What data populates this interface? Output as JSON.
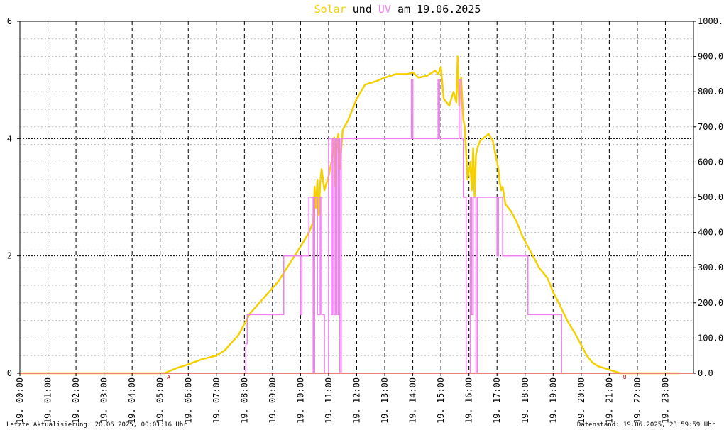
{
  "chart_data": {
    "type": "line",
    "title": {
      "part_solar": "Solar",
      "part_und": " und ",
      "part_uv": "UV",
      "part_date": " am 19.06.2025"
    },
    "colors": {
      "solar": "#f5d000",
      "uv": "#ee82ee",
      "baseline": "#f08080",
      "grid": "#000000",
      "marker": "#d00000"
    },
    "left_axis": {
      "label": "UV",
      "range": [
        0,
        6
      ],
      "ticks": [
        "0",
        "2",
        "4",
        "6"
      ]
    },
    "right_axis": {
      "label": "Solar",
      "range": [
        0,
        1000
      ],
      "ticks": [
        "0.0",
        "100.0",
        "200.0",
        "300.0",
        "400.0",
        "500.0",
        "600.0",
        "700.0",
        "800.0",
        "900.0",
        "1000.0"
      ]
    },
    "x_axis": {
      "range": [
        0,
        24
      ],
      "ticks": [
        "19. 00:00",
        "19. 01:00",
        "19. 02:00",
        "19. 03:00",
        "19. 04:00",
        "19. 05:00",
        "19. 06:00",
        "19. 07:00",
        "19. 08:00",
        "19. 09:00",
        "19. 10:00",
        "19. 11:00",
        "19. 12:00",
        "19. 13:00",
        "19. 14:00",
        "19. 15:00",
        "19. 16:00",
        "19. 17:00",
        "19. 18:00",
        "19. 19:00",
        "19. 20:00",
        "19. 21:00",
        "19. 22:00",
        "19. 23:00"
      ]
    },
    "grid": true,
    "markers": [
      {
        "label": "A",
        "x": 5.3
      },
      {
        "label": "U",
        "x": 21.55
      }
    ],
    "series": [
      {
        "name": "Solar",
        "axis": "right",
        "x": [
          0,
          5.15,
          5.3,
          5.6,
          6.0,
          6.5,
          7.0,
          7.3,
          7.8,
          8.2,
          8.7,
          9.2,
          9.6,
          10.0,
          10.3,
          10.45,
          10.5,
          10.55,
          10.6,
          10.65,
          10.7,
          10.75,
          10.85,
          11.0,
          11.1,
          11.15,
          11.2,
          11.25,
          11.3,
          11.35,
          11.4,
          11.5,
          11.7,
          12.0,
          12.3,
          12.7,
          13.0,
          13.4,
          13.8,
          14.0,
          14.2,
          14.5,
          14.8,
          14.9,
          15.0,
          15.1,
          15.3,
          15.45,
          15.55,
          15.6,
          15.65,
          15.72,
          15.8,
          15.85,
          15.95,
          16.05,
          16.1,
          16.15,
          16.2,
          16.25,
          16.3,
          16.4,
          16.55,
          16.7,
          16.85,
          16.95,
          17.05,
          17.1,
          17.15,
          17.2,
          17.3,
          17.5,
          17.7,
          17.9,
          18.1,
          18.3,
          18.5,
          18.8,
          19.0,
          19.2,
          19.5,
          19.8,
          20.0,
          20.2,
          20.4,
          20.6,
          20.8,
          21.0,
          21.2,
          21.4,
          21.6,
          21.8,
          22.0,
          23.5
        ],
        "values": [
          0,
          0,
          5,
          15,
          25,
          40,
          50,
          65,
          110,
          170,
          215,
          260,
          310,
          360,
          400,
          430,
          530,
          470,
          550,
          450,
          540,
          580,
          520,
          560,
          600,
          620,
          670,
          530,
          650,
          680,
          580,
          690,
          720,
          780,
          820,
          830,
          840,
          850,
          850,
          855,
          840,
          845,
          860,
          850,
          870,
          780,
          760,
          800,
          770,
          900,
          760,
          840,
          720,
          700,
          550,
          600,
          520,
          640,
          500,
          620,
          640,
          660,
          670,
          680,
          660,
          620,
          580,
          540,
          520,
          530,
          480,
          460,
          430,
          390,
          360,
          330,
          300,
          270,
          230,
          200,
          150,
          110,
          80,
          50,
          30,
          20,
          15,
          10,
          5,
          0,
          0,
          0,
          0,
          0
        ]
      },
      {
        "name": "UV",
        "axis": "left",
        "x": [
          0,
          8.05,
          8.05,
          8.1,
          8.1,
          9.4,
          9.4,
          10.0,
          10.0,
          10.05,
          10.05,
          10.3,
          10.3,
          10.45,
          10.45,
          10.5,
          10.5,
          10.6,
          10.6,
          10.7,
          10.7,
          10.75,
          10.75,
          10.85,
          10.85,
          11.0,
          11.0,
          11.1,
          11.1,
          11.15,
          11.15,
          11.2,
          11.2,
          11.25,
          11.25,
          11.3,
          11.3,
          11.35,
          11.35,
          11.4,
          11.4,
          11.45,
          11.45,
          13.95,
          13.95,
          14.0,
          14.0,
          14.9,
          14.9,
          14.95,
          14.95,
          15.65,
          15.65,
          15.72,
          15.72,
          15.8,
          15.8,
          15.9,
          15.9,
          16.05,
          16.05,
          16.1,
          16.1,
          16.15,
          16.15,
          16.25,
          16.25,
          16.3,
          16.3,
          16.35,
          16.35,
          17.0,
          17.0,
          17.05,
          17.05,
          17.2,
          17.2,
          18.1,
          18.1,
          19.3,
          19.3,
          21.55,
          23.5
        ],
        "values": [
          0,
          0,
          0.5,
          0.5,
          1,
          1,
          2,
          2,
          1,
          1,
          2,
          2,
          3,
          3,
          0,
          0,
          3,
          3,
          1,
          1,
          3,
          3,
          1,
          1,
          0,
          0,
          4,
          4,
          1,
          1,
          4,
          4,
          1,
          1,
          4,
          4,
          1,
          1,
          4,
          4,
          0,
          0,
          4,
          4,
          5,
          5,
          4,
          4,
          5,
          5,
          4,
          4,
          5,
          5,
          4,
          4,
          3,
          3,
          0,
          0,
          3,
          3,
          1,
          1,
          3,
          3,
          0,
          0,
          3,
          3,
          3,
          3,
          2,
          2,
          3,
          3,
          2,
          2,
          1,
          1,
          0,
          0,
          0
        ]
      }
    ]
  },
  "footer": {
    "left": "Letzte Aktualisierung: 20.06.2025, 00:01:16 Uhr",
    "right": "Datenstand: 19.06.2025, 23:59:59 Uhr"
  }
}
